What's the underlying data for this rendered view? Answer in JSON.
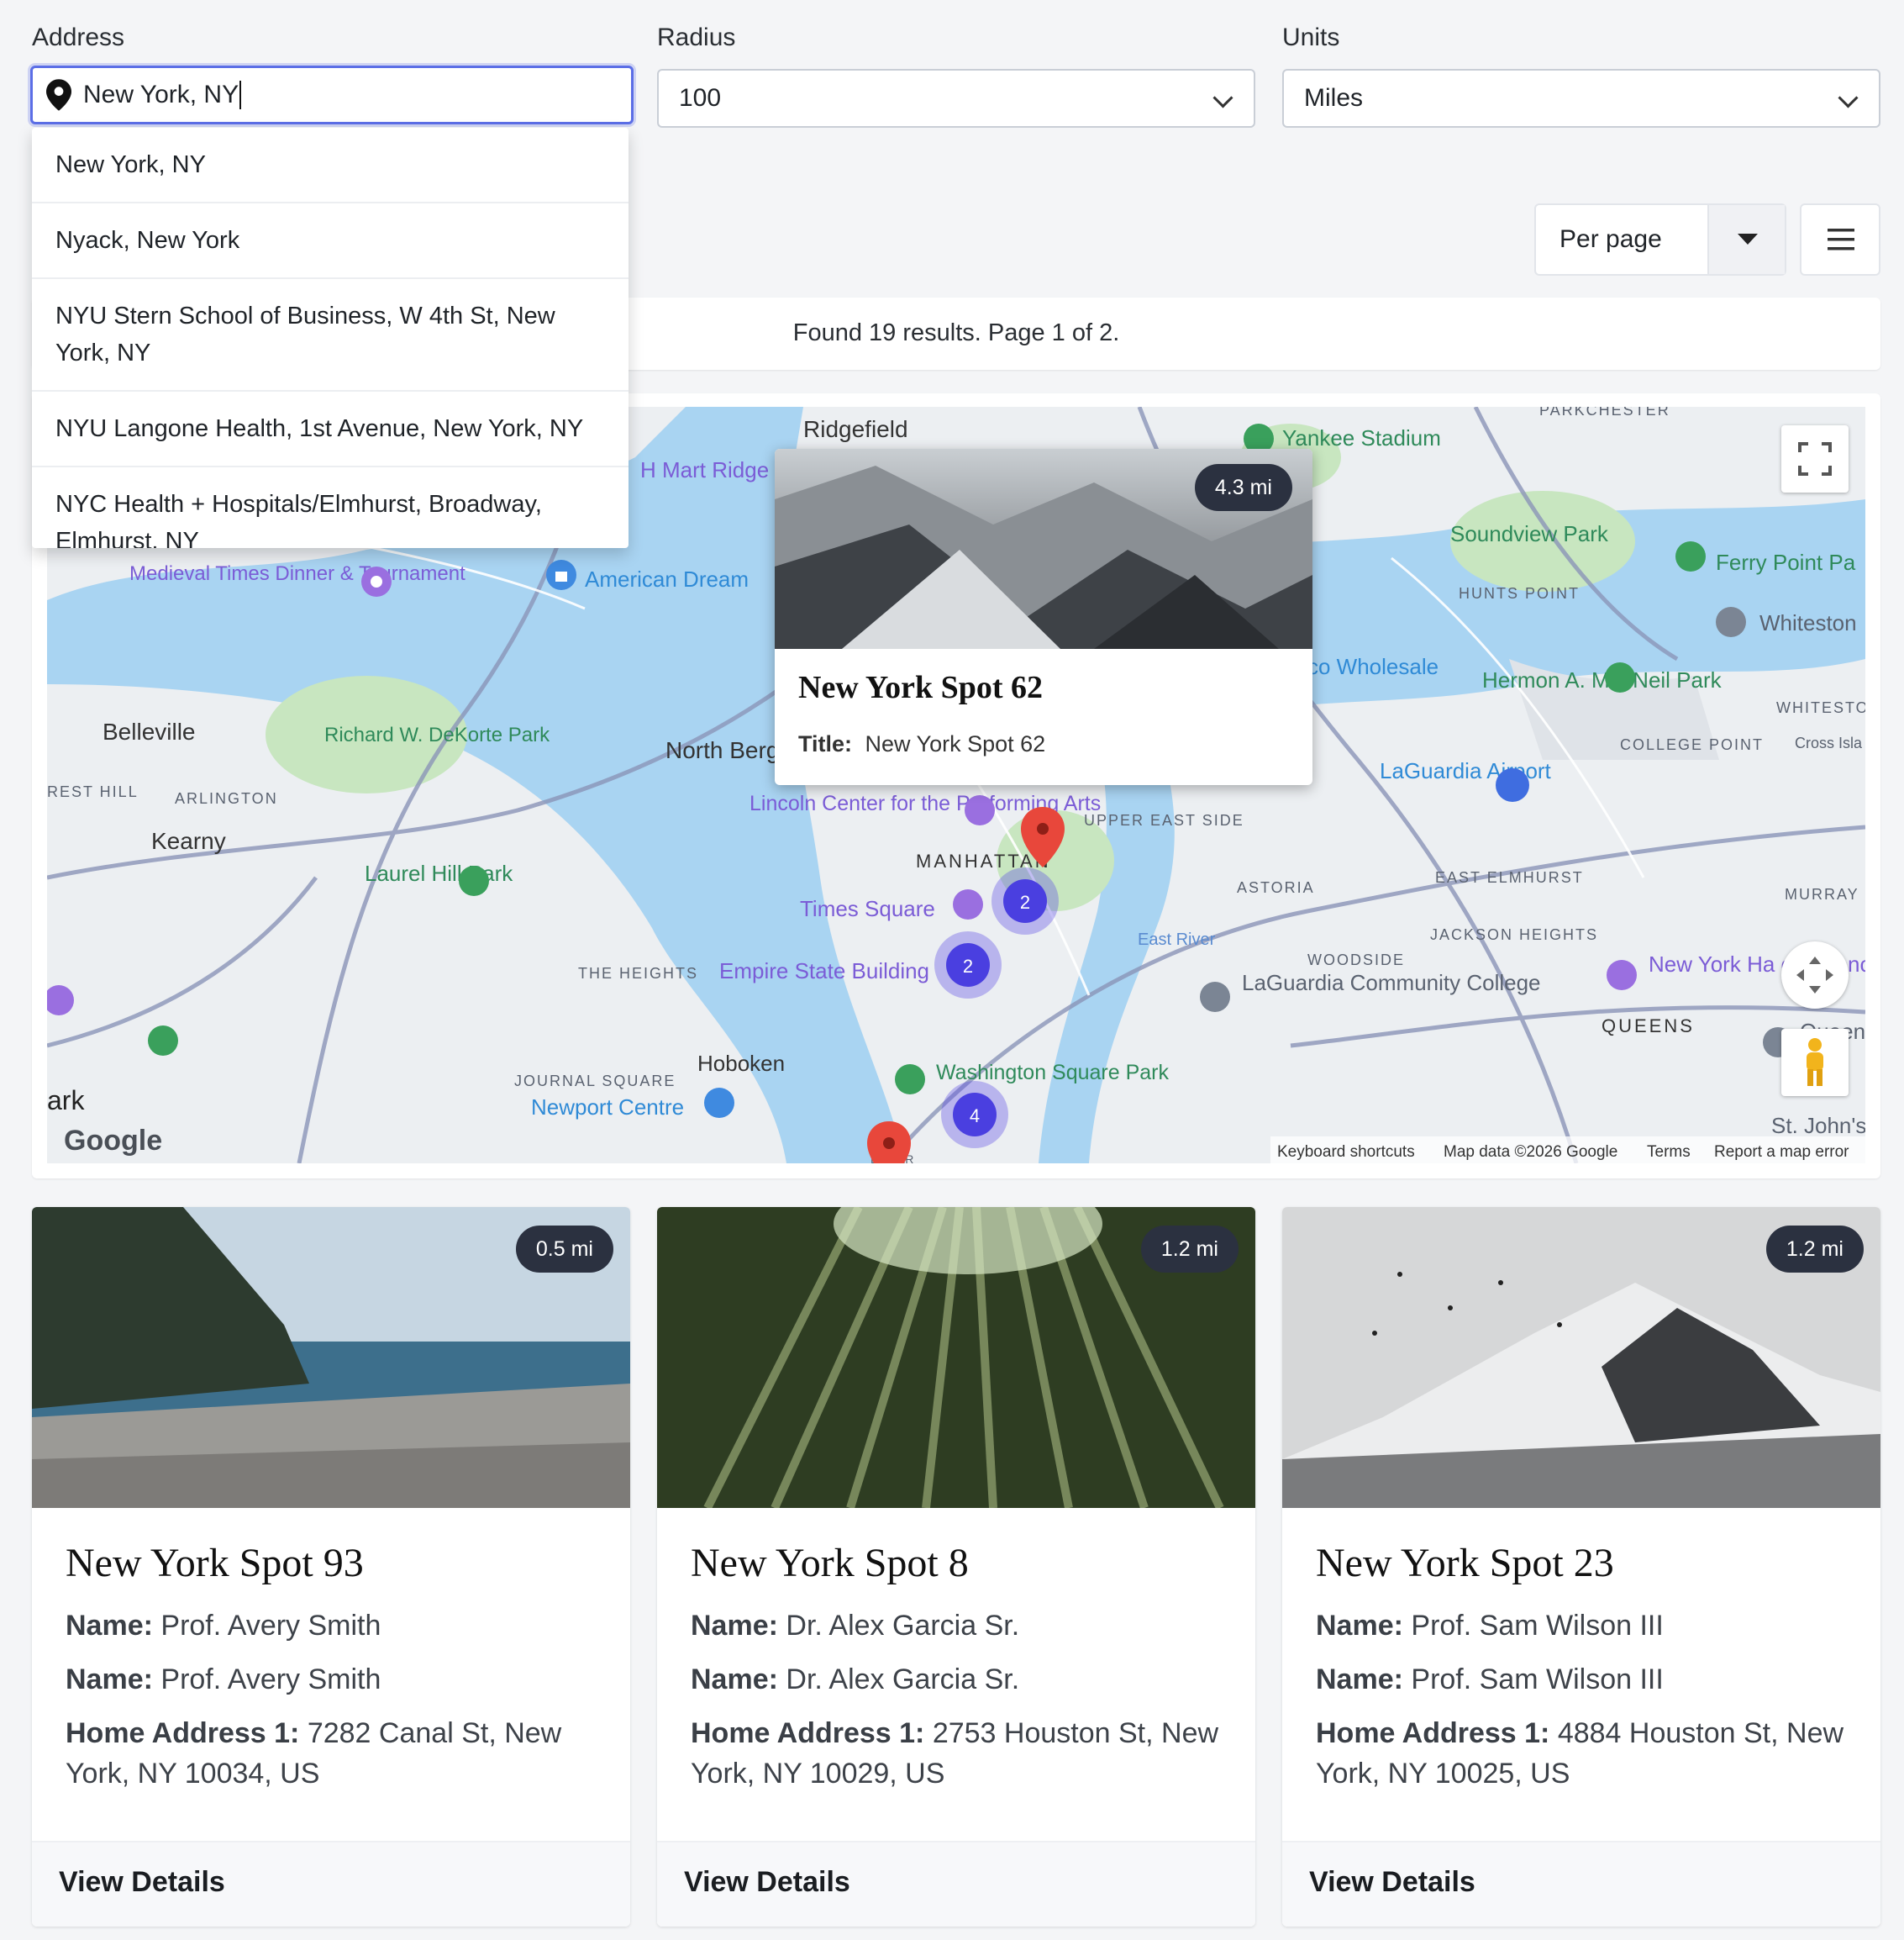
{
  "filters": {
    "address_label": "Address",
    "address_value": "New York, NY",
    "radius_label": "Radius",
    "radius_value": "100",
    "units_label": "Units",
    "units_value": "Miles"
  },
  "suggestions": [
    "New York, NY",
    "Nyack, New York",
    "NYU Stern School of Business, W 4th St, New York, NY",
    "NYU Langone Health, 1st Avenue, New York, NY",
    "NYC Health + Hospitals/Elmhurst, Broadway, Elmhurst, NY"
  ],
  "toolbar": {
    "per_page_label": "Per page"
  },
  "results_text": "Found 19 results. Page 1 of 2.",
  "map": {
    "labels": [
      "Ridgefield",
      "H Mart Ridge",
      "Yankee Stadium",
      "PARKCHESTER",
      "Soundview Park",
      "HUNTS POINT",
      "Ferry Point Pa",
      "Whiteston",
      "Medieval Times Dinner & Tournament",
      "American Dream",
      "Belleville",
      "Richard W. DeKorte Park",
      "North Berg",
      "REST HILL",
      "ARLINGTON",
      "Kearny",
      "Laurel Hill Park",
      "Lincoln Center for the Performing Arts",
      "UPPER EAST SIDE",
      "MANHATTAN",
      "Times Square",
      "Empire State Building",
      "THE HEIGHTS",
      "co Wholesale",
      "Hermon A. MacNeil Park",
      "WHITESTO",
      "COLLEGE POINT",
      "Cross Isla",
      "LaGuardia Airport",
      "ASTORIA",
      "EAST ELMHURST",
      "MURRAY H",
      "JACKSON HEIGHTS",
      "WOODSIDE",
      "LaGuardia Community College",
      "New York Ha of Science",
      "QUEENS",
      "Queen",
      "Hoboken",
      "JOURNAL SQUARE",
      "Newport Centre",
      "Washington Square Park",
      "St. John's",
      "ark",
      "East River",
      "LOWER"
    ],
    "google": "Google",
    "attribution": [
      "Keyboard shortcuts",
      "Map data ©2026 Google",
      "Terms",
      "Report a map error"
    ],
    "clusters": [
      "2",
      "2",
      "4"
    ],
    "popup": {
      "badge": "4.3 mi",
      "title": "New York Spot 62",
      "field_label": "Title:",
      "field_value": "New York Spot 62"
    }
  },
  "cards": [
    {
      "distance": "0.5 mi",
      "title": "New York Spot 93",
      "name_label": "Name:",
      "name": "Prof. Avery Smith",
      "address_label": "Home Address 1:",
      "address": "7282 Canal St, New York, NY 10034, US",
      "action": "View Details"
    },
    {
      "distance": "1.2 mi",
      "title": "New York Spot 8",
      "name_label": "Name:",
      "name": "Dr. Alex Garcia Sr.",
      "address_label": "Home Address 1:",
      "address": "2753 Houston St, New York, NY 10029, US",
      "action": "View Details"
    },
    {
      "distance": "1.2 mi",
      "title": "New York Spot 23",
      "name_label": "Name:",
      "name": "Prof. Sam Wilson III",
      "address_label": "Home Address 1:",
      "address": "4884 Houston St, New York, NY 10025, US",
      "action": "View Details"
    }
  ]
}
